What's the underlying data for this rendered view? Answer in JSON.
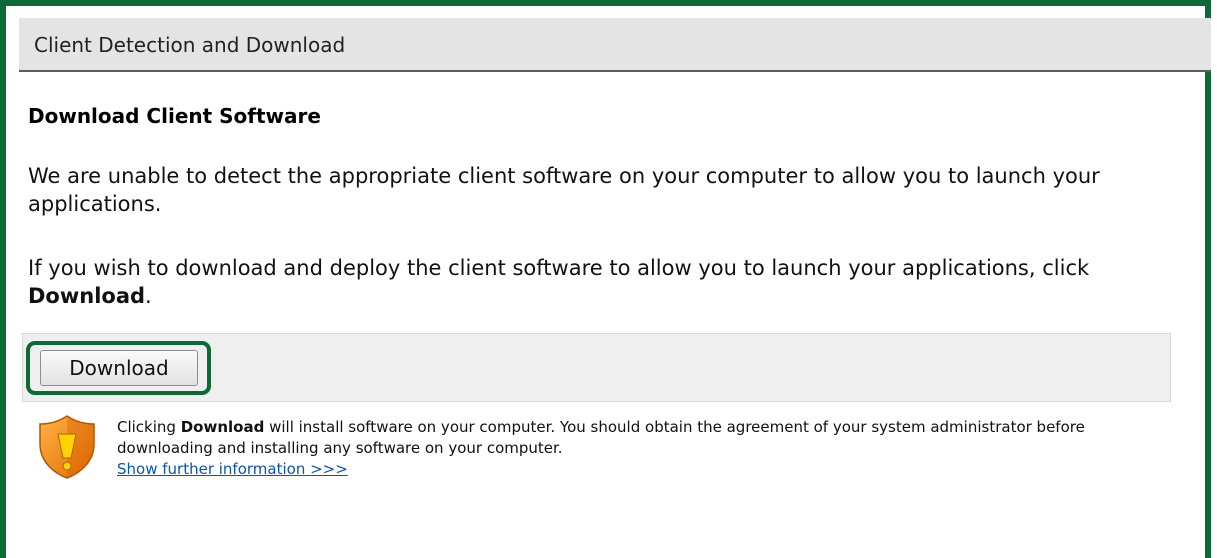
{
  "header": {
    "title": "Client Detection and Download"
  },
  "main": {
    "section_title": "Download Client Software",
    "paragraph1": "We are unable to detect the appropriate client software on your computer to allow you to launch your applications.",
    "paragraph2_prefix": "If you wish to download and deploy the client software to allow you to launch your applications, click ",
    "paragraph2_bold": "Download",
    "paragraph2_suffix": "."
  },
  "download_button": {
    "label": "Download"
  },
  "notice": {
    "icon": "security-shield-warning-icon",
    "prefix": "Clicking ",
    "bold": "Download",
    "suffix": " will install software on your computer. You should obtain the agreement of your system administrator before downloading and installing any software on your computer.",
    "link_label": "Show further information >>>"
  },
  "colors": {
    "frame_border": "#0b6a35",
    "header_background": "#e4e4e4",
    "link": "#0a54b8",
    "shield_orange": "#f08a1c",
    "shield_yellow": "#ffd200"
  }
}
